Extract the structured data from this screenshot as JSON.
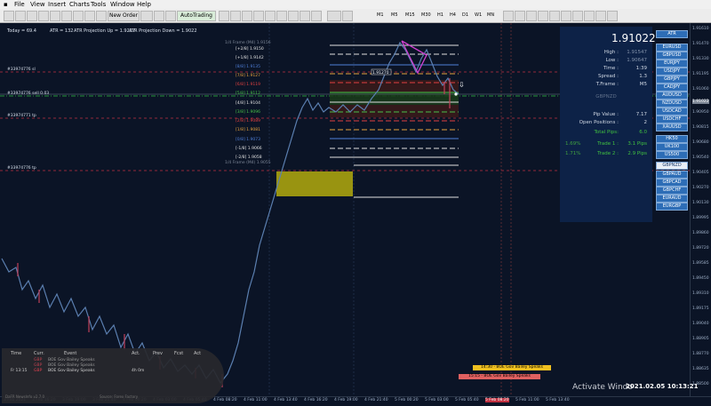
{
  "menu": [
    "File",
    "View",
    "Insert",
    "Charts",
    "Tools",
    "Window",
    "Help"
  ],
  "toolbar": {
    "new_order": "New Order",
    "autotrading": "AutoTrading",
    "timeframes": [
      "M1",
      "M5",
      "M15",
      "M30",
      "H1",
      "H4",
      "D1",
      "W1",
      "MN"
    ]
  },
  "top_info": {
    "today": "Today = 69.4",
    "atr": "ATR = 132",
    "atr_up": "ATR Projection Up = 1.9217",
    "atr_down": "ATR Projection Down = 1.9022"
  },
  "order_labels": {
    "sl": "#33974776 sl",
    "sell": "#33974776 sell 0.03",
    "tp": "#33974771 tp",
    "tp2": "#33974776 tp"
  },
  "murrey": {
    "header": "1/4 Frame (M4) 1.9156",
    "levels": [
      {
        "label": "[+2/8] 1.9150",
        "color": "#e0e0e0"
      },
      {
        "label": "[+1/8] 1.9142",
        "color": "#e0e0e0"
      },
      {
        "label": "[8/8] 1.9135",
        "color": "#4f7fd8"
      },
      {
        "label": "[7/8] 1.9127",
        "color": "#e6a23c"
      },
      {
        "label": "[6/8] 1.9119",
        "color": "#e04040"
      },
      {
        "label": "[5/8] 1.9112",
        "color": "#48c048"
      },
      {
        "label": "[4/8] 1.9104",
        "color": "#e0e0e0"
      },
      {
        "label": "[3/8] 1.9096",
        "color": "#48c048"
      },
      {
        "label": "[2/8] 1.9089",
        "color": "#e04040"
      },
      {
        "label": "[1/8] 1.9081",
        "color": "#e6a23c"
      },
      {
        "label": "[0/8] 1.9073",
        "color": "#4f7fd8"
      },
      {
        "label": "[-1/8] 1.9066",
        "color": "#e0e0e0"
      },
      {
        "label": "[-2/8] 1.9058",
        "color": "#e0e0e0"
      }
    ],
    "footer": "1/4 Frame (M4) 1.9055"
  },
  "price_box_label": "1.91270",
  "panel": {
    "price": "1.91022",
    "rows": [
      {
        "k": "High :",
        "v": "1.91547"
      },
      {
        "k": "Low :",
        "v": "1.90647"
      },
      {
        "k": "Time :",
        "v": "1:39"
      },
      {
        "k": "Spread :",
        "v": "1.3"
      },
      {
        "k": "T.Frame :",
        "v": "M5"
      }
    ],
    "mid_label": "GBPNZD",
    "rows2": [
      {
        "k": "Pip Value :",
        "v": "7.17"
      },
      {
        "k": "Open Positions :",
        "v": "2"
      },
      {
        "k": "Total Pips:",
        "v": "6.0"
      }
    ],
    "trades": [
      {
        "pct": "1.69%",
        "k": "Trade 1 :",
        "v": "3.1 Pips"
      },
      {
        "pct": "1.71%",
        "k": "Trade 2 :",
        "v": "2.9 Pips"
      }
    ]
  },
  "symbols": [
    "ATR",
    "EURUSD",
    "GBPUSD",
    "EURJPY",
    "USDJPY",
    "GBPJPY",
    "CADJPY",
    "AUDUSD",
    "NZDUSD",
    "USDCAD",
    "USDCHF",
    "XAUUSD",
    "HK50",
    "UK100",
    "US500",
    "GBPNZD",
    "GBPAUD",
    "GBPCAD",
    "GBPCHF",
    "EURAUD",
    "EURGBP"
  ],
  "price_axis": [
    "1.91610",
    "1.91470",
    "1.91330",
    "1.91195",
    "1.91060",
    "1.91022",
    "1.90950",
    "1.90815",
    "1.90680",
    "1.90540",
    "1.90405",
    "1.90270",
    "1.90130",
    "1.89995",
    "1.89860",
    "1.89720",
    "1.89585",
    "1.89450",
    "1.89310",
    "1.89175",
    "1.89040",
    "1.88905",
    "1.88770",
    "1.88635",
    "1.88500"
  ],
  "time_axis": [
    "3 Feb 2021",
    "3 Feb 16:20",
    "3 Feb 19:00",
    "3 Feb 21:40",
    "4 Feb 00:20",
    "4 Feb 03:00",
    "4 Feb 05:40",
    "4 Feb 08:20",
    "4 Feb 11:00",
    "4 Feb 13:40",
    "4 Feb 16:20",
    "4 Feb 19:00",
    "4 Feb 21:40",
    "5 Feb 00:20",
    "5 Feb 03:00",
    "5 Feb 05:40",
    "5 Feb 08:20",
    "5 Feb 11:00",
    "5 Feb 13:40"
  ],
  "calendar": {
    "headers": [
      "Time",
      "Curr.",
      "Event",
      "Act.",
      "Prev",
      "Fcst",
      "Act"
    ],
    "rows": [
      {
        "time": "",
        "curr": "GBP",
        "event": "BOE Gov Bailey Speaks",
        "a": "",
        "p": "",
        "f": ""
      },
      {
        "time": "",
        "curr": "GBP",
        "event": "BOE Gov Bailey Speaks",
        "a": "",
        "p": "",
        "f": ""
      },
      {
        "time": "Fr 13:15",
        "curr": "GBP",
        "event": "BOE Gov Bailey Speaks",
        "a": "4h 0m",
        "p": "",
        "f": ""
      }
    ],
    "footer_left": "DaFR NewsInfo v2.7.0",
    "footer_right": "Source: Forex Factory"
  },
  "news_tags": [
    {
      "text": "14:30 - BOE Gov Bailey Speaks",
      "color": "#f0c020"
    },
    {
      "text": "15:15 - BOE Gov Bailey Speaks",
      "color": "#e06060"
    }
  ],
  "watermark": "Activate Windo",
  "clock": "2021.02.05 10:13:21"
}
